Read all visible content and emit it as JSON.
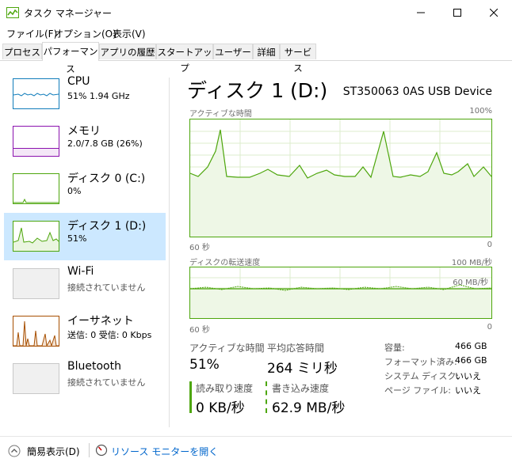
{
  "window": {
    "title": "タスク マネージャー"
  },
  "menu": [
    "ファイル(F)",
    "オプション(O)",
    "表示(V)"
  ],
  "tabs": [
    "プロセス",
    "パフォーマンス",
    "アプリの履歴",
    "スタートアップ",
    "ユーザー",
    "詳細",
    "サービス"
  ],
  "sidebar": [
    {
      "title": "CPU",
      "sub": "51%  1.94 GHz"
    },
    {
      "title": "メモリ",
      "sub": "2.0/7.8 GB (26%)"
    },
    {
      "title": "ディスク 0 (C:)",
      "sub": "0%"
    },
    {
      "title": "ディスク 1 (D:)",
      "sub": "51%"
    },
    {
      "title": "Wi-Fi",
      "sub": "接続されていません"
    },
    {
      "title": "イーサネット",
      "sub": "送信: 0  受信: 0 Kbps"
    },
    {
      "title": "Bluetooth",
      "sub": "接続されていません"
    }
  ],
  "main": {
    "title": "ディスク 1 (D:)",
    "device": "ST350063 0AS USB Device",
    "graph1": {
      "label": "アクティブな時間",
      "max": "100%",
      "left_axis": "60 秒",
      "right_axis": "0"
    },
    "graph2": {
      "label": "ディスクの転送速度",
      "max": "100 MB/秒",
      "mid": "60 MB/秒",
      "left_axis": "60 秒",
      "right_axis": "0"
    },
    "stats": {
      "active_label": "アクティブな時間",
      "active_value": "51%",
      "resp_label": "平均応答時間",
      "resp_value": "264 ミリ秒",
      "read_label": "読み取り速度",
      "read_value": "0 KB/秒",
      "write_label": "書き込み速度",
      "write_value": "62.9 MB/秒"
    },
    "props": [
      {
        "k": "容量:",
        "v": "466 GB"
      },
      {
        "k": "フォーマット済み:",
        "v": "466 GB"
      },
      {
        "k": "システム ディスク:",
        "v": "いいえ"
      },
      {
        "k": "ページ ファイル:",
        "v": "いいえ"
      }
    ]
  },
  "footer": {
    "simple": "簡易表示(D)",
    "resmon": "リソース モニターを開く"
  },
  "colors": {
    "disk_green": "#4da60c",
    "cpu_blue": "#117dbb",
    "mem_purple": "#8b12ae",
    "eth_orange": "#a74f01",
    "select": "#cce8ff"
  }
}
